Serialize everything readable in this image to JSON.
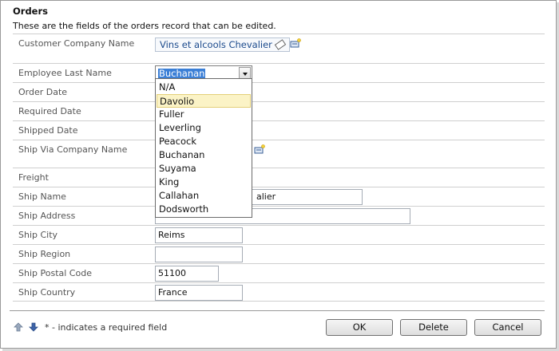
{
  "form": {
    "title": "Orders",
    "description": "These are the fields of the orders record that can be edited."
  },
  "fields": {
    "customer_company": {
      "label": "Customer Company Name",
      "value": "Vins et alcools Chevalier"
    },
    "employee_last_name": {
      "label": "Employee Last Name",
      "value": "Buchanan"
    },
    "order_date": {
      "label": "Order Date",
      "value": ""
    },
    "required_date": {
      "label": "Required Date",
      "value": ""
    },
    "shipped_date": {
      "label": "Shipped Date",
      "value": ""
    },
    "ship_via": {
      "label": "Ship Via Company Name",
      "value": ""
    },
    "freight": {
      "label": "Freight",
      "value": ""
    },
    "ship_name": {
      "label": "Ship Name",
      "value": "alier"
    },
    "ship_address": {
      "label": "Ship Address",
      "value": ""
    },
    "ship_city": {
      "label": "Ship City",
      "value": "Reims"
    },
    "ship_region": {
      "label": "Ship Region",
      "value": ""
    },
    "ship_postal_code": {
      "label": "Ship Postal Code",
      "value": "51100"
    },
    "ship_country": {
      "label": "Ship Country",
      "value": "France"
    }
  },
  "employee_dropdown": {
    "options": [
      "N/A",
      "Davolio",
      "Fuller",
      "Leverling",
      "Peacock",
      "Buchanan",
      "Suyama",
      "King",
      "Callahan",
      "Dodsworth"
    ],
    "hovered": "Davolio"
  },
  "footer": {
    "required_note": "* - indicates a required field",
    "ok_label": "OK",
    "delete_label": "Delete",
    "cancel_label": "Cancel"
  },
  "colors": {
    "selection": "#3b7fd6",
    "hover_option": "#fbf3c6",
    "link": "#1b4a8c"
  }
}
